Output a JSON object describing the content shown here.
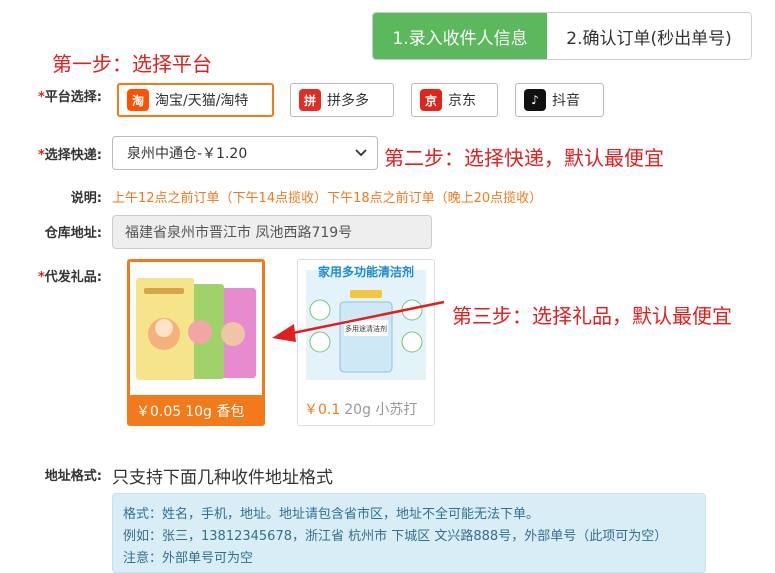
{
  "steps": {
    "step1": "1.录入收件人信息",
    "step2": "2.确认订单(秒出单号)"
  },
  "notes": {
    "step_one": "第一步：选择平台",
    "step_two": "第二步：选择快递，默认最便宜",
    "step_three": "第三步：选择礼品，默认最便宜"
  },
  "platform": {
    "label": "平台选择:",
    "options": [
      {
        "label": "淘宝/天猫/淘特",
        "icon": "taobao-icon",
        "color": "#ff5000",
        "glyph": "淘"
      },
      {
        "label": "拼多多",
        "icon": "pinduoduo-icon",
        "color": "#e02e24",
        "glyph": "拼"
      },
      {
        "label": "京东",
        "icon": "jd-icon",
        "color": "#e1251b",
        "glyph": "京"
      },
      {
        "label": "抖音",
        "icon": "douyin-icon",
        "color": "#111111",
        "glyph": "♪"
      }
    ]
  },
  "express": {
    "label": "选择快递:",
    "selected": "泉州中通仓-￥1.20"
  },
  "description": {
    "label": "说明:",
    "text": "上午12点之前订单（下午14点揽收）下午18点之前订单（晚上20点揽收）"
  },
  "warehouse": {
    "label": "仓库地址:",
    "value": "福建省泉州市晋江市 凤池西路719号"
  },
  "gifts": {
    "label": "代发礼品:",
    "items": [
      {
        "price": "￥0.05",
        "name": "10g 香包",
        "selected": true
      },
      {
        "price": "￥0.1",
        "name": "20g 小苏打",
        "selected": false,
        "banner": "家用多功能清洁剂",
        "package_title": "多用途清洁剂"
      }
    ]
  },
  "address_format": {
    "label": "地址格式:",
    "desc": "只支持下面几种收件地址格式",
    "line1": "格式：姓名，手机，地址。地址请包含省市区，地址不全可能无法下单。",
    "line2": "例如：张三，13812345678，浙江省 杭州市 下城区 文兴路888号，外部单号（此项可为空）",
    "line3": "注意：外部单号可为空"
  },
  "colors": {
    "accent_green": "#5cb85c",
    "accent_orange": "#f27a1a",
    "note_red": "#e02020",
    "info_bg": "#d9edf7"
  }
}
